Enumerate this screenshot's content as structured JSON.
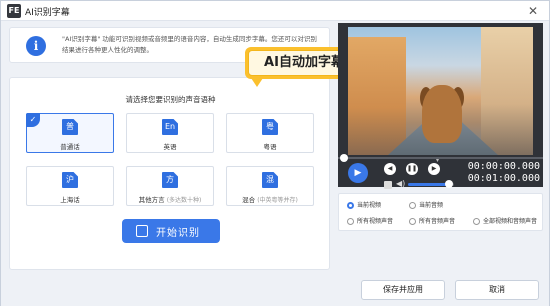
{
  "window": {
    "title": "AI识别字幕",
    "logo": "FE"
  },
  "info": {
    "icon": "i",
    "text": "\"AI识别字幕\" 功能可识别视频或音频里的语音内容，自动生成同步字幕。您还可以对识别结果进行各种更人性化的调整。"
  },
  "callout": {
    "text": "AI自动加字幕"
  },
  "main": {
    "prompt": "请选择您要识别的声音语种",
    "languages": [
      {
        "icon": "普",
        "label": "普通话",
        "sub": "",
        "selected": true
      },
      {
        "icon": "En",
        "label": "英语",
        "sub": "",
        "selected": false
      },
      {
        "icon": "粤",
        "label": "粤语",
        "sub": "",
        "selected": false
      },
      {
        "icon": "沪",
        "label": "上海话",
        "sub": "",
        "selected": false
      },
      {
        "icon": "方",
        "label": "其他方言",
        "sub": "(多达数十种)",
        "selected": false
      },
      {
        "icon": "混",
        "label": "混合",
        "sub": "(中英粤等并存)",
        "selected": false
      }
    ],
    "start_label": "开始识别"
  },
  "player": {
    "time_current": "00:00:00.000",
    "time_total": "00:01:00.000",
    "volume": 0.9,
    "progress": 0.0
  },
  "options": [
    {
      "label": "当前视频",
      "checked": true
    },
    {
      "label": "当前音频",
      "checked": false
    },
    {
      "label": "所有视频声音",
      "checked": false
    },
    {
      "label": "所有音频声音",
      "checked": false
    },
    {
      "label": "全部视频和音频声音",
      "checked": false
    }
  ],
  "footer": {
    "save_label": "保存并应用",
    "cancel_label": "取消"
  },
  "colors": {
    "accent": "#3a78e8",
    "callout": "#fbc02d"
  }
}
